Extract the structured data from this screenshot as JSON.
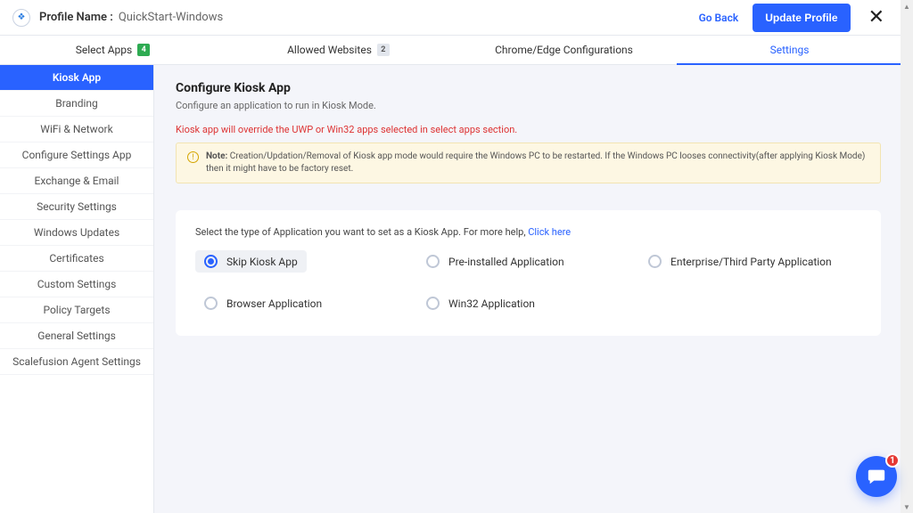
{
  "header": {
    "profile_label": "Profile Name :",
    "profile_value": "QuickStart-Windows",
    "go_back": "Go Back",
    "update": "Update Profile"
  },
  "tabs": [
    {
      "label": "Select Apps",
      "badge": "4",
      "badge_style": "green"
    },
    {
      "label": "Allowed Websites",
      "badge": "2",
      "badge_style": "grey"
    },
    {
      "label": "Chrome/Edge Configurations"
    },
    {
      "label": "Settings",
      "active": true
    }
  ],
  "sidebar": [
    "Kiosk App",
    "Branding",
    "WiFi & Network",
    "Configure Settings App",
    "Exchange & Email",
    "Security Settings",
    "Windows Updates",
    "Certificates",
    "Custom Settings",
    "Policy Targets",
    "General Settings",
    "Scalefusion Agent Settings"
  ],
  "sidebar_active": 0,
  "main": {
    "title": "Configure Kiosk App",
    "subtitle": "Configure an application to run in Kiosk Mode.",
    "override_warning": "Kiosk app will override the UWP or Win32 apps selected in select apps section.",
    "note_prefix": "Note:",
    "note_body": "Creation/Updation/Removal of Kiosk app mode would require the Windows PC to be restarted. If the Windows PC looses connectivity(after applying Kiosk Mode) then it might have to be factory reset.",
    "help_text": "Select the type of Application you want to set as a Kiosk App. For more help, ",
    "help_link": "Click here",
    "options": [
      "Skip Kiosk App",
      "Pre-installed Application",
      "Enterprise/Third Party Application",
      "Browser Application",
      "Win32 Application"
    ],
    "selected_option": 0
  },
  "chat_badge": "1"
}
